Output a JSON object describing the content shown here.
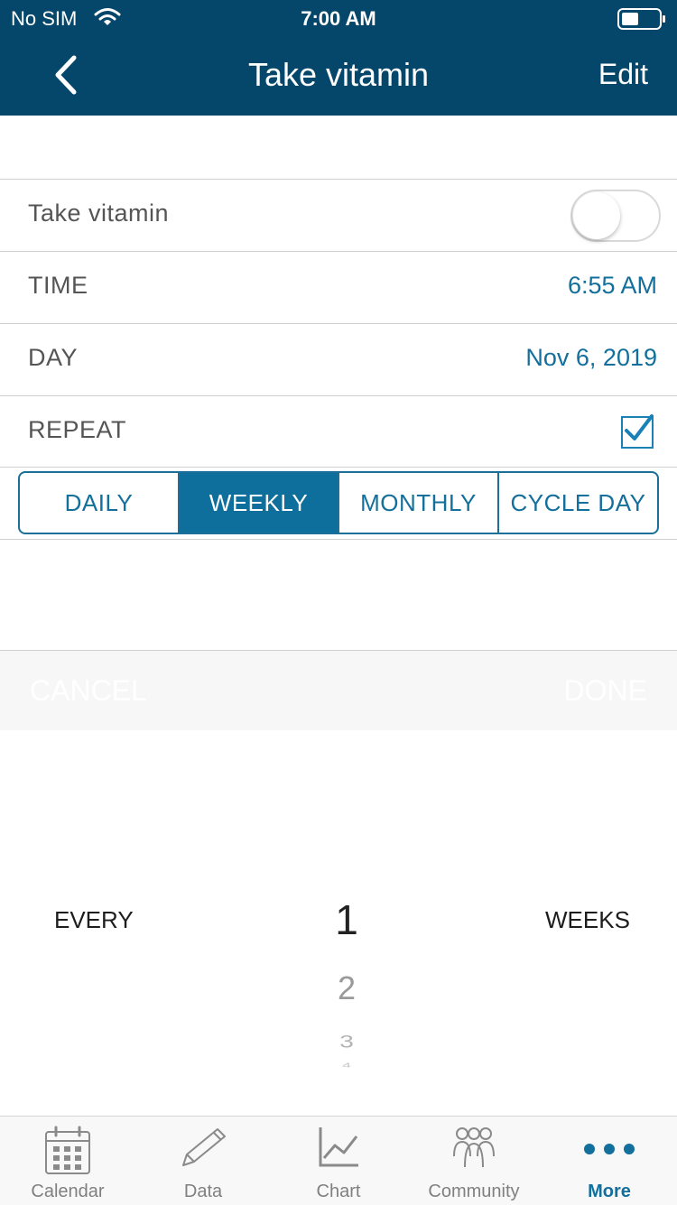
{
  "status_bar": {
    "carrier": "No SIM",
    "time": "7:00 AM"
  },
  "header": {
    "title": "Take vitamin",
    "edit_label": "Edit"
  },
  "reminder": {
    "name": "Take vitamin",
    "enabled": false,
    "time_label": "TIME",
    "time_value": "6:55 AM",
    "day_label": "DAY",
    "day_value": "Nov 6, 2019",
    "repeat_label": "REPEAT",
    "repeat_checked": true
  },
  "repeat_options": {
    "items": [
      "DAILY",
      "WEEKLY",
      "MONTHLY",
      "CYCLE DAY"
    ],
    "selected": "WEEKLY"
  },
  "picker": {
    "cancel_label": "CANCEL",
    "done_label": "DONE",
    "prefix": "EVERY",
    "suffix": "WEEKS",
    "values": [
      "1",
      "2",
      "3",
      "4"
    ],
    "selected": "1"
  },
  "tabbar": {
    "items": [
      "Calendar",
      "Data",
      "Chart",
      "Community",
      "More"
    ],
    "active": "More"
  },
  "colors": {
    "header_bg": "#04476a",
    "accent": "#136f9b",
    "segment_active": "#0f6f9c"
  }
}
